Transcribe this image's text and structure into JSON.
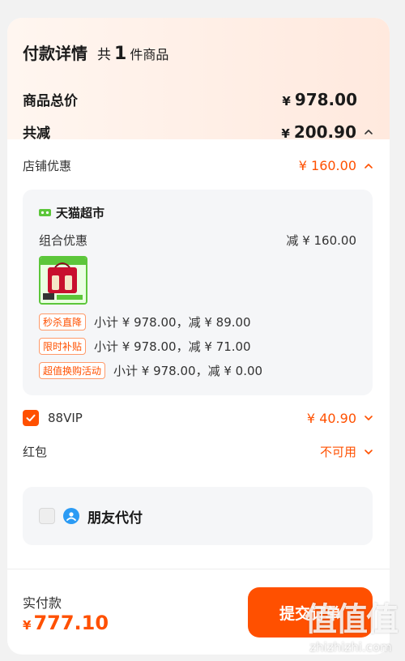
{
  "header": {
    "title": "付款详情",
    "gong": "共",
    "count": "1",
    "unit": "件商品"
  },
  "summary": {
    "total_label": "商品总价",
    "total_yen": "¥",
    "total_value": "978.00",
    "reduce_label": "共减",
    "reduce_yen": "¥",
    "reduce_value": "200.90",
    "shop_discount_label": "店铺优惠",
    "shop_discount_value": "¥ 160.00"
  },
  "shop": {
    "name": "天猫超市",
    "combo_label": "组合优惠",
    "combo_value": "减 ¥ 160.00",
    "discounts": [
      {
        "tag": "秒杀直降",
        "text": "小计 ¥ 978.00，减 ¥ 89.00"
      },
      {
        "tag": "限时补贴",
        "text": "小计 ¥ 978.00，减 ¥ 71.00"
      },
      {
        "tag": "超值换购活动",
        "text": "小计 ¥ 978.00，减 ¥ 0.00"
      }
    ]
  },
  "vip": {
    "label": "88VIP",
    "value": "¥ 40.90",
    "checked": true
  },
  "redpacket": {
    "label": "红包",
    "value": "不可用"
  },
  "friend": {
    "label": "朋友代付"
  },
  "footer": {
    "pay_label": "实付款",
    "pay_yen": "¥",
    "pay_value": "777.10",
    "submit_label": "提交订单"
  },
  "watermark": {
    "big": "值值值",
    "small": "zhizhizhi.com"
  },
  "colors": {
    "accent": "#ff5000",
    "tmall_green": "#5cc63a",
    "friend_blue": "#2b9bf4"
  }
}
